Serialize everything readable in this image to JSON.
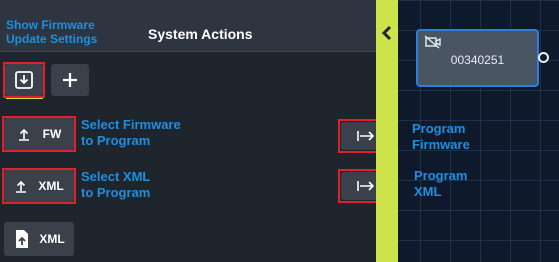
{
  "panel": {
    "title": "System Actions",
    "annotation_top": "Show Firmware\nUpdate Settings",
    "icons": {
      "collapse": "chevron-left-icon",
      "download": "download-icon",
      "add": "plus-icon",
      "upload": "upload-arrow-icon",
      "arrow": "arrow-to-bar-icon",
      "file_upload": "file-upload-icon"
    },
    "buttons": {
      "fw_label": "FW",
      "xml_label": "XML",
      "xml_file_label": "XML"
    },
    "annotations": {
      "select_fw": "Select Firmware\nto Program",
      "select_xml": "Select XML\nto Program",
      "program_fw": "Program\nFirmware",
      "program_xml": "Program\nXML"
    }
  },
  "canvas": {
    "node": {
      "label": "00340251",
      "icon": "no-video-icon"
    }
  },
  "colors": {
    "accent": "#cde34a",
    "highlight_box": "#e0202a",
    "annotation": "#1e8fe0",
    "node_border": "#2a7fd8"
  }
}
